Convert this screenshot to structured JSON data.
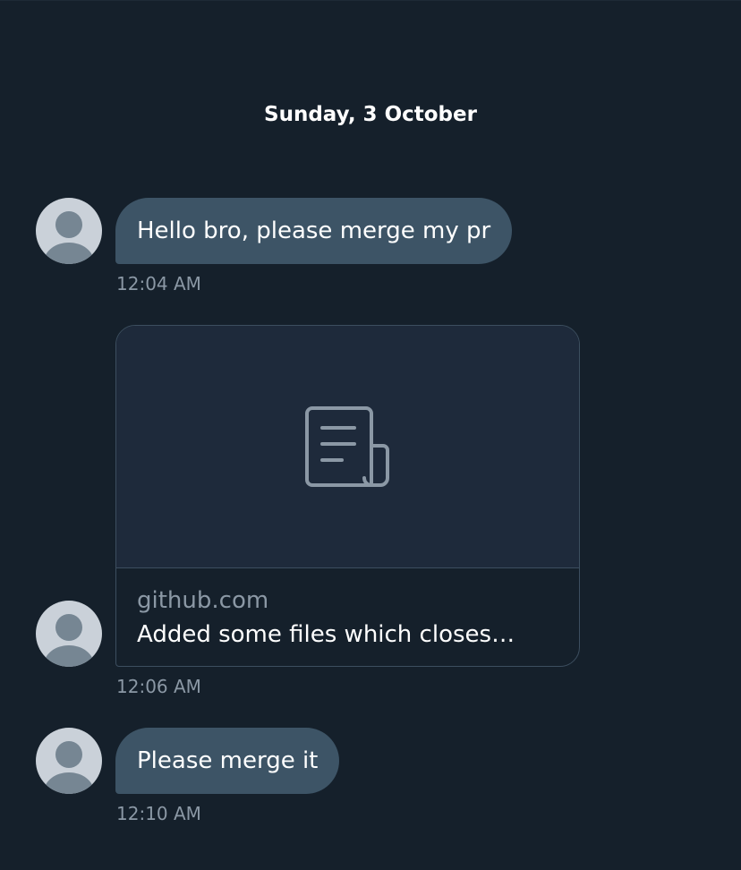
{
  "conversation": {
    "date_separator": "Sunday, 3 October",
    "messages": [
      {
        "type": "text",
        "text": "Hello bro, please merge my pr",
        "time": "12:04 AM"
      },
      {
        "type": "link",
        "domain": "github.com",
        "title": "Added some files which closes…",
        "icon": "document-icon",
        "time": "12:06 AM"
      },
      {
        "type": "text",
        "text": "Please merge it",
        "time": "12:10 AM"
      }
    ]
  },
  "colors": {
    "background": "#15202b",
    "bubble": "#3d5466",
    "card_preview": "#1e2a3b",
    "card_border": "#3c4e5f",
    "muted_text": "#8b98a5",
    "avatar": "#cad1d9",
    "avatar_figure": "#768693"
  }
}
